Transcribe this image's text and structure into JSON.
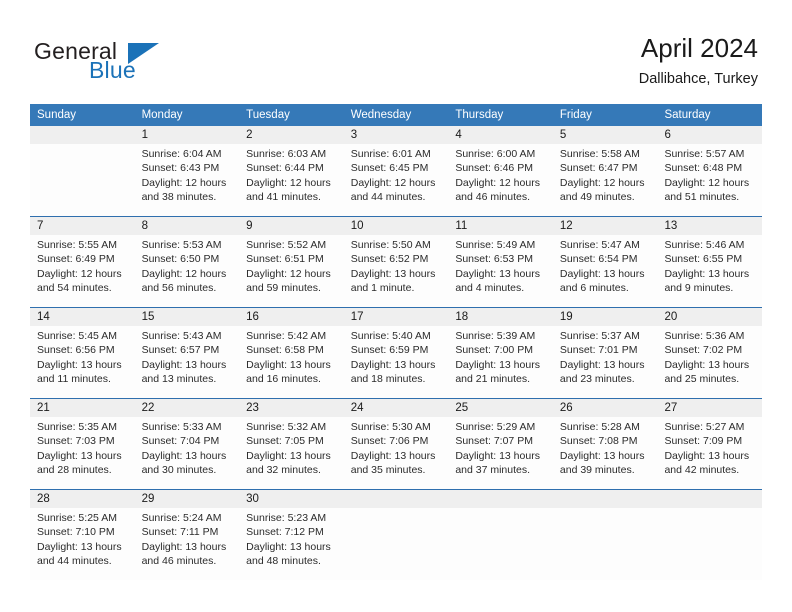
{
  "brand": {
    "name_part1": "General",
    "name_part2": "Blue",
    "colors": {
      "blue": "#1b72b8",
      "dark": "#231f20"
    }
  },
  "header": {
    "title": "April 2024",
    "subtitle": "Dallibahce, Turkey"
  },
  "calendar": {
    "header_bg": "#3579b8",
    "header_text": "#ffffff",
    "daynum_bg": "#efefef",
    "cell_bg": "#fdfdfd",
    "weekdays": [
      "Sunday",
      "Monday",
      "Tuesday",
      "Wednesday",
      "Thursday",
      "Friday",
      "Saturday"
    ],
    "weeks": [
      [
        {
          "day": "",
          "lines": []
        },
        {
          "day": "1",
          "lines": [
            "Sunrise: 6:04 AM",
            "Sunset: 6:43 PM",
            "Daylight: 12 hours",
            "and 38 minutes."
          ]
        },
        {
          "day": "2",
          "lines": [
            "Sunrise: 6:03 AM",
            "Sunset: 6:44 PM",
            "Daylight: 12 hours",
            "and 41 minutes."
          ]
        },
        {
          "day": "3",
          "lines": [
            "Sunrise: 6:01 AM",
            "Sunset: 6:45 PM",
            "Daylight: 12 hours",
            "and 44 minutes."
          ]
        },
        {
          "day": "4",
          "lines": [
            "Sunrise: 6:00 AM",
            "Sunset: 6:46 PM",
            "Daylight: 12 hours",
            "and 46 minutes."
          ]
        },
        {
          "day": "5",
          "lines": [
            "Sunrise: 5:58 AM",
            "Sunset: 6:47 PM",
            "Daylight: 12 hours",
            "and 49 minutes."
          ]
        },
        {
          "day": "6",
          "lines": [
            "Sunrise: 5:57 AM",
            "Sunset: 6:48 PM",
            "Daylight: 12 hours",
            "and 51 minutes."
          ]
        }
      ],
      [
        {
          "day": "7",
          "lines": [
            "Sunrise: 5:55 AM",
            "Sunset: 6:49 PM",
            "Daylight: 12 hours",
            "and 54 minutes."
          ]
        },
        {
          "day": "8",
          "lines": [
            "Sunrise: 5:53 AM",
            "Sunset: 6:50 PM",
            "Daylight: 12 hours",
            "and 56 minutes."
          ]
        },
        {
          "day": "9",
          "lines": [
            "Sunrise: 5:52 AM",
            "Sunset: 6:51 PM",
            "Daylight: 12 hours",
            "and 59 minutes."
          ]
        },
        {
          "day": "10",
          "lines": [
            "Sunrise: 5:50 AM",
            "Sunset: 6:52 PM",
            "Daylight: 13 hours",
            "and 1 minute."
          ]
        },
        {
          "day": "11",
          "lines": [
            "Sunrise: 5:49 AM",
            "Sunset: 6:53 PM",
            "Daylight: 13 hours",
            "and 4 minutes."
          ]
        },
        {
          "day": "12",
          "lines": [
            "Sunrise: 5:47 AM",
            "Sunset: 6:54 PM",
            "Daylight: 13 hours",
            "and 6 minutes."
          ]
        },
        {
          "day": "13",
          "lines": [
            "Sunrise: 5:46 AM",
            "Sunset: 6:55 PM",
            "Daylight: 13 hours",
            "and 9 minutes."
          ]
        }
      ],
      [
        {
          "day": "14",
          "lines": [
            "Sunrise: 5:45 AM",
            "Sunset: 6:56 PM",
            "Daylight: 13 hours",
            "and 11 minutes."
          ]
        },
        {
          "day": "15",
          "lines": [
            "Sunrise: 5:43 AM",
            "Sunset: 6:57 PM",
            "Daylight: 13 hours",
            "and 13 minutes."
          ]
        },
        {
          "day": "16",
          "lines": [
            "Sunrise: 5:42 AM",
            "Sunset: 6:58 PM",
            "Daylight: 13 hours",
            "and 16 minutes."
          ]
        },
        {
          "day": "17",
          "lines": [
            "Sunrise: 5:40 AM",
            "Sunset: 6:59 PM",
            "Daylight: 13 hours",
            "and 18 minutes."
          ]
        },
        {
          "day": "18",
          "lines": [
            "Sunrise: 5:39 AM",
            "Sunset: 7:00 PM",
            "Daylight: 13 hours",
            "and 21 minutes."
          ]
        },
        {
          "day": "19",
          "lines": [
            "Sunrise: 5:37 AM",
            "Sunset: 7:01 PM",
            "Daylight: 13 hours",
            "and 23 minutes."
          ]
        },
        {
          "day": "20",
          "lines": [
            "Sunrise: 5:36 AM",
            "Sunset: 7:02 PM",
            "Daylight: 13 hours",
            "and 25 minutes."
          ]
        }
      ],
      [
        {
          "day": "21",
          "lines": [
            "Sunrise: 5:35 AM",
            "Sunset: 7:03 PM",
            "Daylight: 13 hours",
            "and 28 minutes."
          ]
        },
        {
          "day": "22",
          "lines": [
            "Sunrise: 5:33 AM",
            "Sunset: 7:04 PM",
            "Daylight: 13 hours",
            "and 30 minutes."
          ]
        },
        {
          "day": "23",
          "lines": [
            "Sunrise: 5:32 AM",
            "Sunset: 7:05 PM",
            "Daylight: 13 hours",
            "and 32 minutes."
          ]
        },
        {
          "day": "24",
          "lines": [
            "Sunrise: 5:30 AM",
            "Sunset: 7:06 PM",
            "Daylight: 13 hours",
            "and 35 minutes."
          ]
        },
        {
          "day": "25",
          "lines": [
            "Sunrise: 5:29 AM",
            "Sunset: 7:07 PM",
            "Daylight: 13 hours",
            "and 37 minutes."
          ]
        },
        {
          "day": "26",
          "lines": [
            "Sunrise: 5:28 AM",
            "Sunset: 7:08 PM",
            "Daylight: 13 hours",
            "and 39 minutes."
          ]
        },
        {
          "day": "27",
          "lines": [
            "Sunrise: 5:27 AM",
            "Sunset: 7:09 PM",
            "Daylight: 13 hours",
            "and 42 minutes."
          ]
        }
      ],
      [
        {
          "day": "28",
          "lines": [
            "Sunrise: 5:25 AM",
            "Sunset: 7:10 PM",
            "Daylight: 13 hours",
            "and 44 minutes."
          ]
        },
        {
          "day": "29",
          "lines": [
            "Sunrise: 5:24 AM",
            "Sunset: 7:11 PM",
            "Daylight: 13 hours",
            "and 46 minutes."
          ]
        },
        {
          "day": "30",
          "lines": [
            "Sunrise: 5:23 AM",
            "Sunset: 7:12 PM",
            "Daylight: 13 hours",
            "and 48 minutes."
          ]
        },
        {
          "day": "",
          "lines": []
        },
        {
          "day": "",
          "lines": []
        },
        {
          "day": "",
          "lines": []
        },
        {
          "day": "",
          "lines": []
        }
      ]
    ]
  }
}
